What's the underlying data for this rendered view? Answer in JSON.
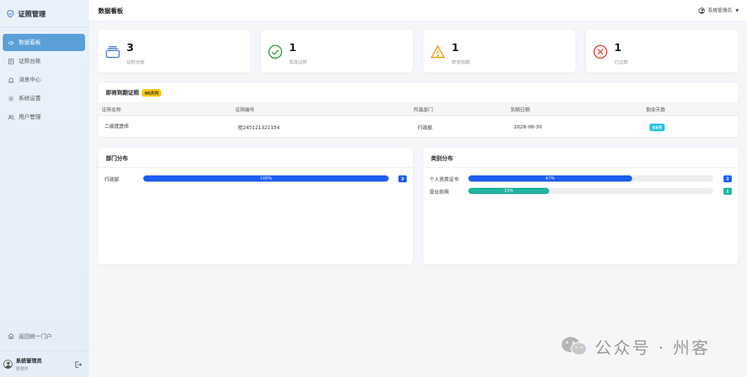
{
  "app": {
    "brand": "证照管理"
  },
  "sidebar": {
    "items": [
      {
        "label": "数据看板",
        "icon": "dashboard-icon",
        "active": true
      },
      {
        "label": "证照台账",
        "icon": "ledger-icon",
        "active": false
      },
      {
        "label": "消息中心",
        "icon": "bell-icon",
        "active": false
      },
      {
        "label": "系统设置",
        "icon": "gear-icon",
        "active": false
      },
      {
        "label": "用户管理",
        "icon": "users-icon",
        "active": false
      }
    ],
    "back_portal": "返回统一门户",
    "user": {
      "name": "系统管理员",
      "role": "管理员"
    }
  },
  "header": {
    "title": "数据看板",
    "user": "系统管理员"
  },
  "stats": [
    {
      "value": "3",
      "label": "证照总数",
      "icon": "stack-icon",
      "color": "#3b6fd6"
    },
    {
      "value": "1",
      "label": "有效证照",
      "icon": "check-circle-icon",
      "color": "#2ea44f"
    },
    {
      "value": "1",
      "label": "即将到期",
      "icon": "warning-icon",
      "color": "#f39c12"
    },
    {
      "value": "1",
      "label": "已过期",
      "icon": "x-circle-icon",
      "color": "#e74c3c"
    }
  ],
  "expiring": {
    "title": "即将到期证照",
    "badge": "90天内",
    "columns": [
      "证照名称",
      "证照编号",
      "所属部门",
      "到期日期",
      "剩余天数"
    ],
    "rows": [
      {
        "name": "二级建造师",
        "number": "桂245121321154",
        "dept": "行政部",
        "date": "2026-06-30",
        "days": "58天"
      }
    ]
  },
  "dept_dist": {
    "title": "部门分布",
    "rows": [
      {
        "name": "行政部",
        "percent": 100,
        "label": "100%",
        "count": "3"
      }
    ]
  },
  "category_dist": {
    "title": "类别分布",
    "rows": [
      {
        "name": "个人资质证书",
        "percent": 67,
        "label": "67%",
        "count": "2",
        "color": "#1e5ef0"
      },
      {
        "name": "营业执照",
        "percent": 33,
        "label": "33%",
        "count": "1",
        "color": "#1fb3a0"
      }
    ]
  },
  "watermark": {
    "text": "公众号 · 州客"
  }
}
